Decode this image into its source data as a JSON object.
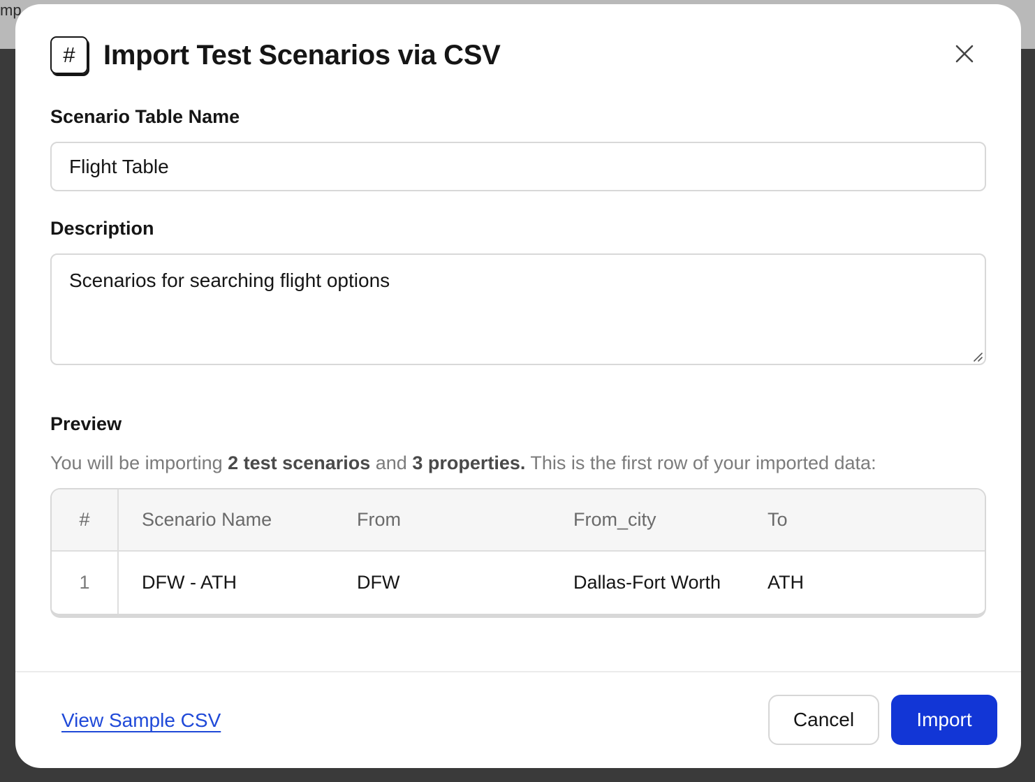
{
  "background": {
    "partial_text": "mp"
  },
  "dialog": {
    "title": "Import Test Scenarios via CSV",
    "icon": "hash-icon"
  },
  "form": {
    "name_label": "Scenario Table Name",
    "name_value": "Flight Table",
    "description_label": "Description",
    "description_value": "Scenarios for searching flight options"
  },
  "preview": {
    "label": "Preview",
    "text_before": "You will be importing ",
    "scenarios_count": "2 test scenarios",
    "text_middle": " and ",
    "properties_count": "3 properties.",
    "text_after": " This is the first row of your imported data:",
    "table": {
      "headers": [
        "#",
        "Scenario Name",
        "From",
        "From_city",
        "To"
      ],
      "rows": [
        [
          "1",
          "DFW - ATH",
          "DFW",
          "Dallas-Fort Worth",
          "ATH"
        ]
      ]
    }
  },
  "footer": {
    "sample_link": "View Sample CSV",
    "cancel_label": "Cancel",
    "import_label": "Import"
  },
  "colors": {
    "accent": "#1236d6",
    "link": "#1f49d8"
  }
}
